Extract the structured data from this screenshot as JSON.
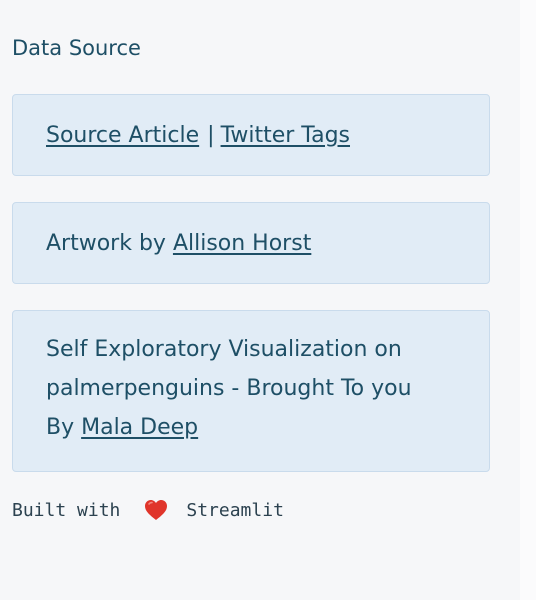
{
  "sidebar": {
    "section_title": "Data Source",
    "boxes": {
      "sources": {
        "source_article": "Source Article",
        "separator": "|",
        "twitter_tags": "Twitter Tags"
      },
      "artwork": {
        "prefix": "Artwork by ",
        "artist": "Allison Horst"
      },
      "about": {
        "line1": "Self Exploratory Visualization on",
        "line2": "palmerpenguins - Brought To you",
        "by": "By ",
        "author": "Mala Deep"
      }
    },
    "footer": {
      "built_with": "Built with",
      "heart_icon": "heart-icon",
      "heart_color": "#e0352b",
      "framework": "Streamlit"
    }
  },
  "colors": {
    "text": "#1e4f66",
    "box_bg": "#e1ecf6",
    "box_border": "#c9dbec",
    "page_bg": "#f6f7f9"
  }
}
